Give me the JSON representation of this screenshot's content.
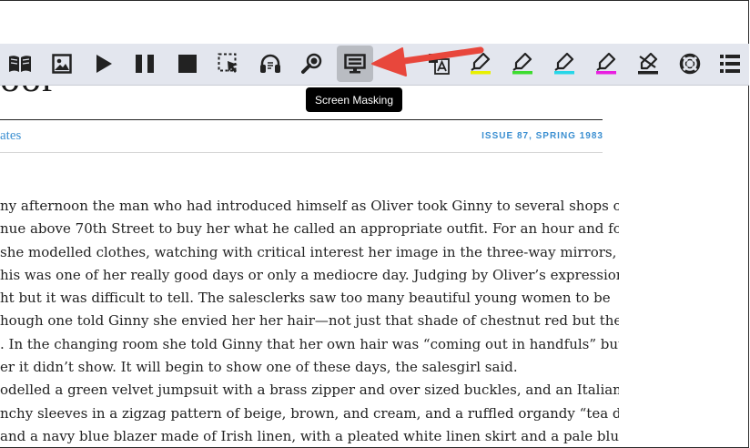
{
  "article": {
    "title_fragment": "oor",
    "byline": "ates",
    "issue": "ISSUE 87, SPRING 1983",
    "lines": [
      "ny afternoon the man who had introduced himself as Oliver took Ginny to several shops on",
      "nue above 70th Street to buy her what he called an appropriate outfit. For an hour and forty-",
      "she modelled clothes, watching with critical interest her image in the three-way mirrors, unable",
      "his was one of her really good days or only a mediocre day. Judging by Oliver’s expression she",
      "ht but it was difficult to tell. The salesclerks saw too many beautiful young women to be",
      "hough one told Ginny she envied her her hair—not just that shade of chestnut red but the",
      ". In the changing room she told Ginny that her own hair was “coming out in handfuls” but",
      "er it didn’t show. It will begin to show one of these days, the salesgirl said.",
      "odelled a green velvet jumpsuit with a brass zipper and over sized buckles, and an Italian knit",
      "nchy sleeves in a zigzag pattern of beige, brown, and cream, and a ruffled organdy “tea dress” in",
      "and a navy blue blazer made of Irish linen, with a pleated white linen skirt and a pale blue silk"
    ]
  },
  "toolbar": {
    "tooltip": "Screen Masking",
    "icons": [
      "book-icon",
      "picture-icon",
      "play-icon",
      "pause-icon",
      "stop-icon",
      "select-region-icon",
      "headphones-icon",
      "magnifier-icon",
      "screen-masking-icon",
      "translate-icon",
      "highlighter-yellow-icon",
      "highlighter-green-icon",
      "highlighter-cyan-icon",
      "highlighter-pink-icon",
      "eraser-icon",
      "lifebuoy-icon",
      "menu-icon"
    ]
  },
  "colors": {
    "toolbar_bg": "#e3e6ee",
    "link_blue": "#3b8fd1",
    "highlight_yellow": "#e8f000",
    "highlight_green": "#3ddc2f",
    "highlight_cyan": "#26d6e8",
    "highlight_pink": "#e81ee0",
    "arrow_red": "#e8473c"
  }
}
